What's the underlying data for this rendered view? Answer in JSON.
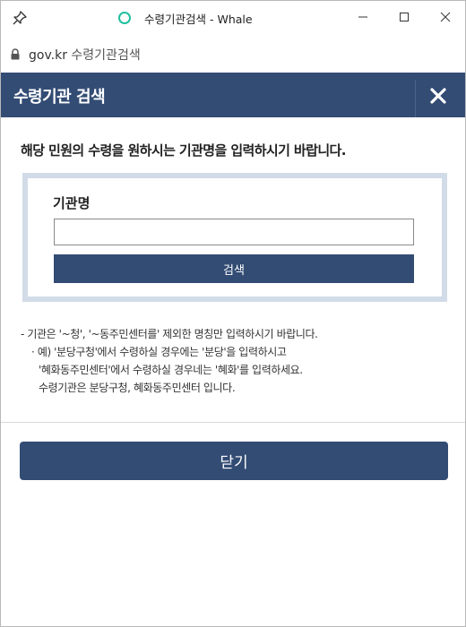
{
  "window": {
    "title": "수령기관검색 - Whale"
  },
  "address_bar": {
    "domain": "gov.kr",
    "page_title": "수령기관검색"
  },
  "dialog": {
    "title": "수령기관 검색",
    "header_color": "#334c74"
  },
  "form": {
    "instruction": "해당 민원의 수령을 원하시는 기관명을 입력하시기 바랍니다.",
    "field_label": "기관명",
    "input_value": "",
    "search_button_label": "검색"
  },
  "notes": {
    "line1": "- 기관은 '~청', '~동주민센터를' 제외한 명칭만 입력하시기 바랍니다.",
    "line2": "· 예) '분당구청'에서 수령하실 경우에는 '분당'을 입력하시고",
    "line3": "'혜화동주민센터'에서 수령하실 경우네는 '혜화'를 입력하세요.",
    "line4": "수령기관은 분당구청, 혜화동주민센터 입니다."
  },
  "footer": {
    "close_button_label": "닫기"
  }
}
